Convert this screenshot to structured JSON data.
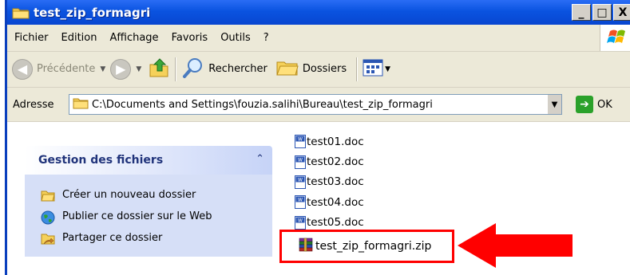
{
  "window": {
    "title": "test_zip_formagri",
    "buttons": {
      "minimize": "_",
      "maximize": "□",
      "close": "X"
    }
  },
  "menu": {
    "items": [
      "Fichier",
      "Edition",
      "Affichage",
      "Favoris",
      "Outils",
      "?"
    ]
  },
  "toolbar": {
    "back_label": "Précédente",
    "search_label": "Rechercher",
    "folders_label": "Dossiers"
  },
  "address": {
    "label": "Adresse",
    "path": "C:\\Documents and Settings\\fouzia.salihi\\Bureau\\test_zip_formagri",
    "go_label": "OK"
  },
  "task_pane": {
    "title": "Gestion des fichiers",
    "links": [
      "Créer un nouveau dossier",
      "Publier ce dossier sur le Web",
      "Partager ce dossier"
    ]
  },
  "files": {
    "docs": [
      "test01.doc",
      "test02.doc",
      "test03.doc",
      "test04.doc",
      "test05.doc"
    ],
    "zip": "test_zip_formagri.zip"
  },
  "colors": {
    "titlebar": "#0a53e0",
    "highlight": "#ff0000",
    "task_body": "#d6dff7"
  },
  "icons": {
    "title": "folder-icon",
    "back": "arrow-left-icon",
    "forward": "arrow-right-icon",
    "up": "folder-up-icon",
    "search": "search-icon",
    "folders": "folders-icon",
    "views": "views-icon",
    "go": "go-arrow-icon",
    "collapse": "chevron-up-icon"
  }
}
